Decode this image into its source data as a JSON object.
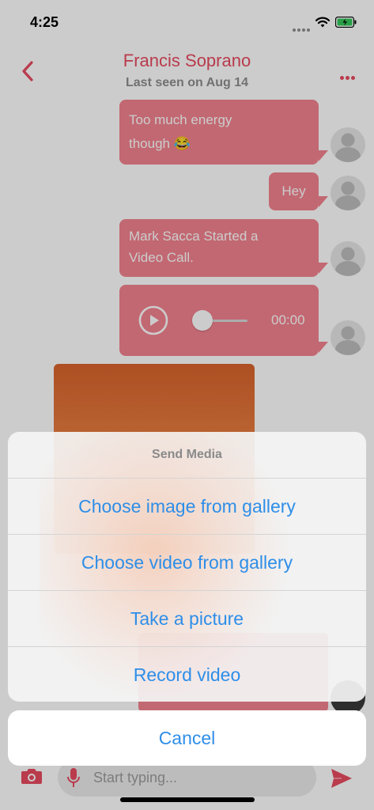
{
  "status_bar": {
    "time": "4:25",
    "battery_charging": true
  },
  "header": {
    "contact_name": "Francis Soprano",
    "last_seen": "Last seen on Aug 14"
  },
  "messages": [
    {
      "type": "text",
      "line1": "Too much energy",
      "line2": "though 😂"
    },
    {
      "type": "text",
      "line1": "Hey"
    },
    {
      "type": "text",
      "line1": "Mark Sacca Started a",
      "line2": "Video Call."
    },
    {
      "type": "audio",
      "time": "00:00",
      "progress": 0
    },
    {
      "type": "image"
    }
  ],
  "input_bar": {
    "placeholder": "Start typing..."
  },
  "action_sheet": {
    "title": "Send Media",
    "options": [
      "Choose image from gallery",
      "Choose video from gallery",
      "Take a picture",
      "Record video"
    ],
    "cancel_label": "Cancel"
  },
  "colors": {
    "accent": "#e84a5f",
    "bubble": "#f3838f",
    "action_text": "#2e8ee8"
  },
  "icons": [
    "back-chevron-icon",
    "more-icon",
    "play-icon",
    "camera-icon",
    "microphone-icon",
    "send-icon",
    "wifi-icon",
    "battery-icon"
  ]
}
